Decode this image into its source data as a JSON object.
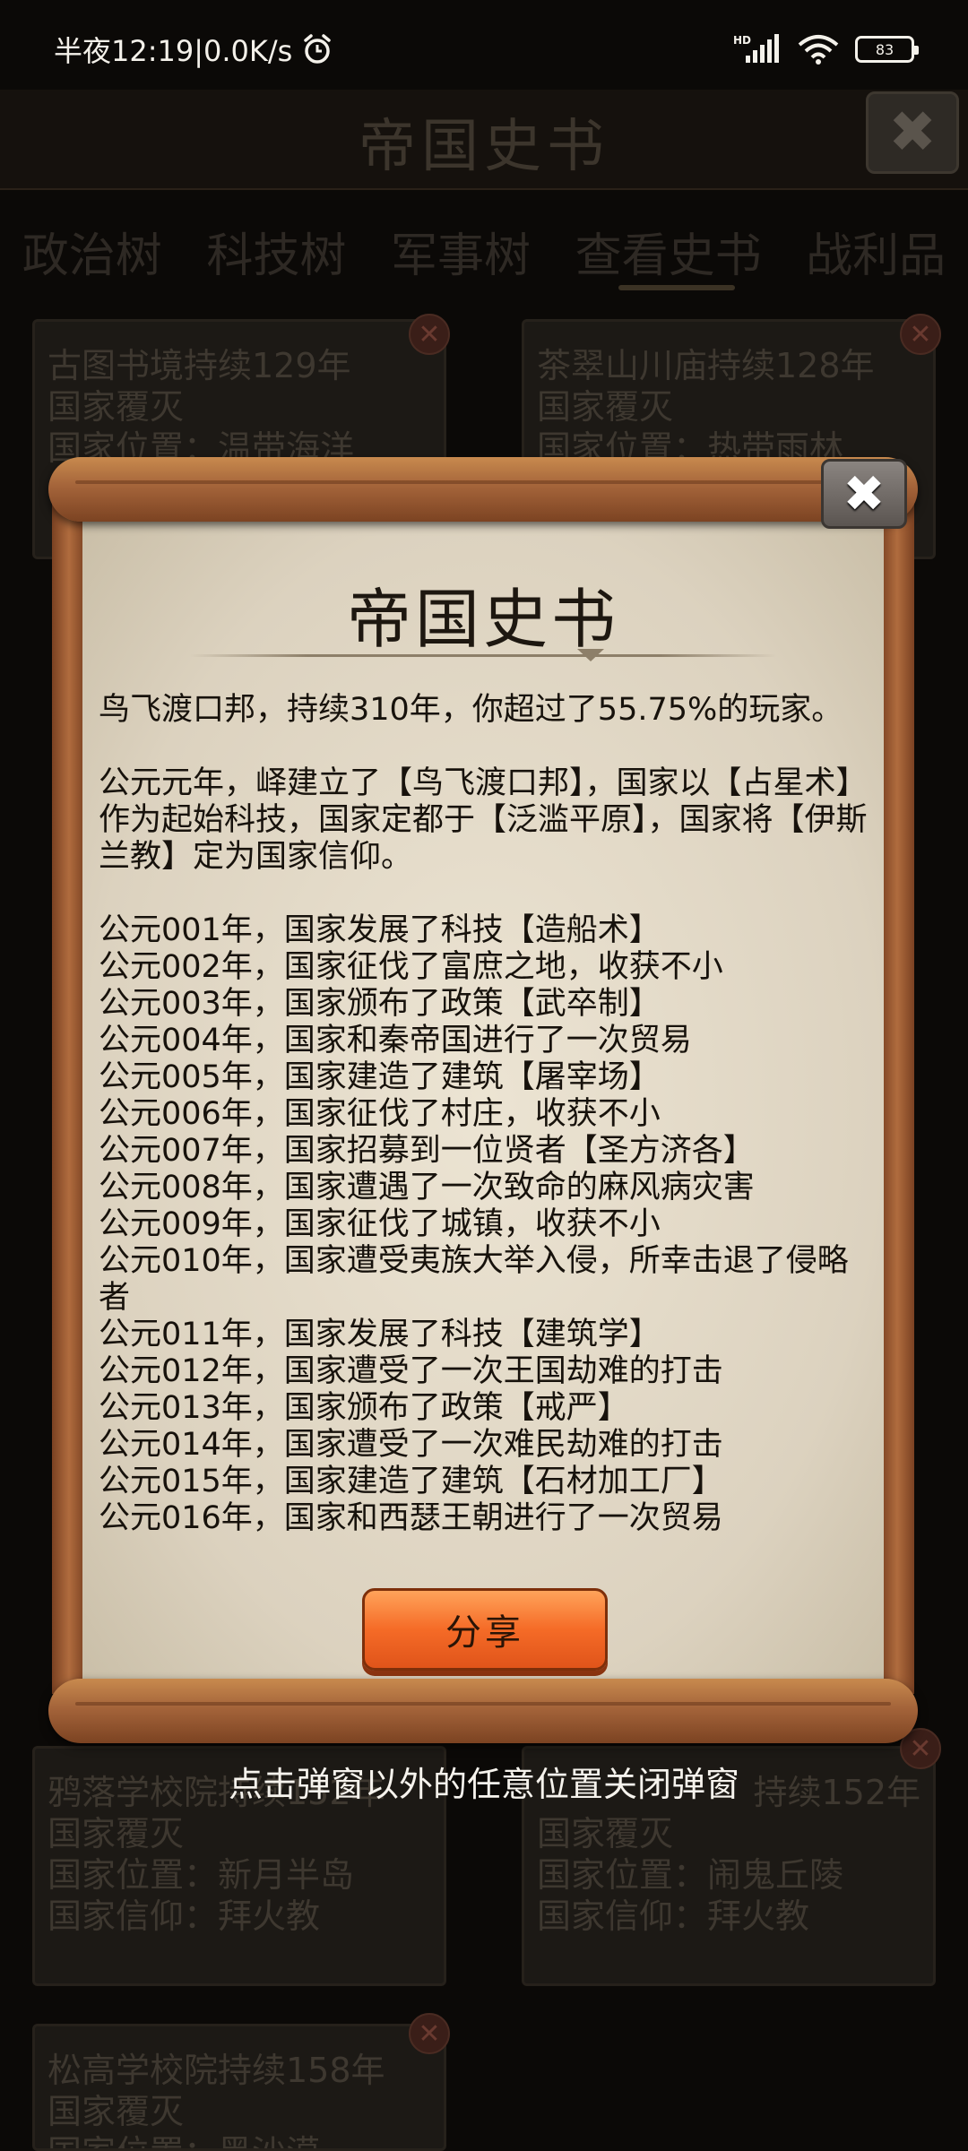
{
  "status_bar": {
    "time_and_speed": "半夜12:19|0.0K/s",
    "network_label": "HD",
    "battery": "83"
  },
  "background": {
    "title": "帝国史书",
    "close_glyph": "✖",
    "tabs": [
      {
        "label": "政治树"
      },
      {
        "label": "科技树"
      },
      {
        "label": "军事树"
      },
      {
        "label": "查看史书"
      },
      {
        "label": "战利品"
      }
    ],
    "cards": [
      {
        "lines": [
          "古图书境持续129年",
          "国家覆灭",
          "国家位置：温带海洋"
        ]
      },
      {
        "lines": [
          "茶翠山川庙持续128年",
          "国家覆灭",
          "国家位置：热带雨林"
        ]
      },
      {
        "lines": [
          "鸦落学校院持续152年",
          "国家覆灭",
          "国家位置：新月半岛",
          "国家信仰：拜火教"
        ]
      },
      {
        "lines": [
          "持续152年",
          "国家覆灭",
          "国家位置：闹鬼丘陵",
          "国家信仰：拜火教"
        ]
      },
      {
        "lines": [
          "松高学校院持续158年",
          "国家覆灭",
          "国家位置：黑沙漠"
        ]
      }
    ]
  },
  "dialog": {
    "title": "帝国史书",
    "close_glyph": "✖",
    "summary": "鸟飞渡口邦，持续310年，你超过了55.75%的玩家。",
    "founding": "公元元年，峄建立了【鸟飞渡口邦】，国家以【占星术】作为起始科技，国家定都于【泛滥平原】，国家将【伊斯兰教】定为国家信仰。",
    "events": [
      "公元001年，国家发展了科技【造船术】",
      "公元002年，国家征伐了富庶之地，收获不小",
      "公元003年，国家颁布了政策【武卒制】",
      "公元004年，国家和秦帝国进行了一次贸易",
      "公元005年，国家建造了建筑【屠宰场】",
      "公元006年，国家征伐了村庄，收获不小",
      "公元007年，国家招募到一位贤者【圣方济各】",
      "公元008年，国家遭遇了一次致命的麻风病灾害",
      "公元009年，国家征伐了城镇，收获不小",
      "公元010年，国家遭受夷族大举入侵，所幸击退了侵略者",
      "公元011年，国家发展了科技【建筑学】",
      "公元012年，国家遭受了一次王国劫难的打击",
      "公元013年，国家颁布了政策【戒严】",
      "公元014年，国家遭受了一次难民劫难的打击",
      "公元015年，国家建造了建筑【石材加工厂】",
      "公元016年，国家和西瑟王朝进行了一次贸易"
    ],
    "share_label": "分享"
  },
  "dismiss_hint": "点击弹窗以外的任意位置关闭弹窗",
  "colors": {
    "scroll_wood": "#a4643a",
    "parchment": "#e6ddca",
    "share_button": "#f56b27",
    "background": "#0b0907"
  }
}
